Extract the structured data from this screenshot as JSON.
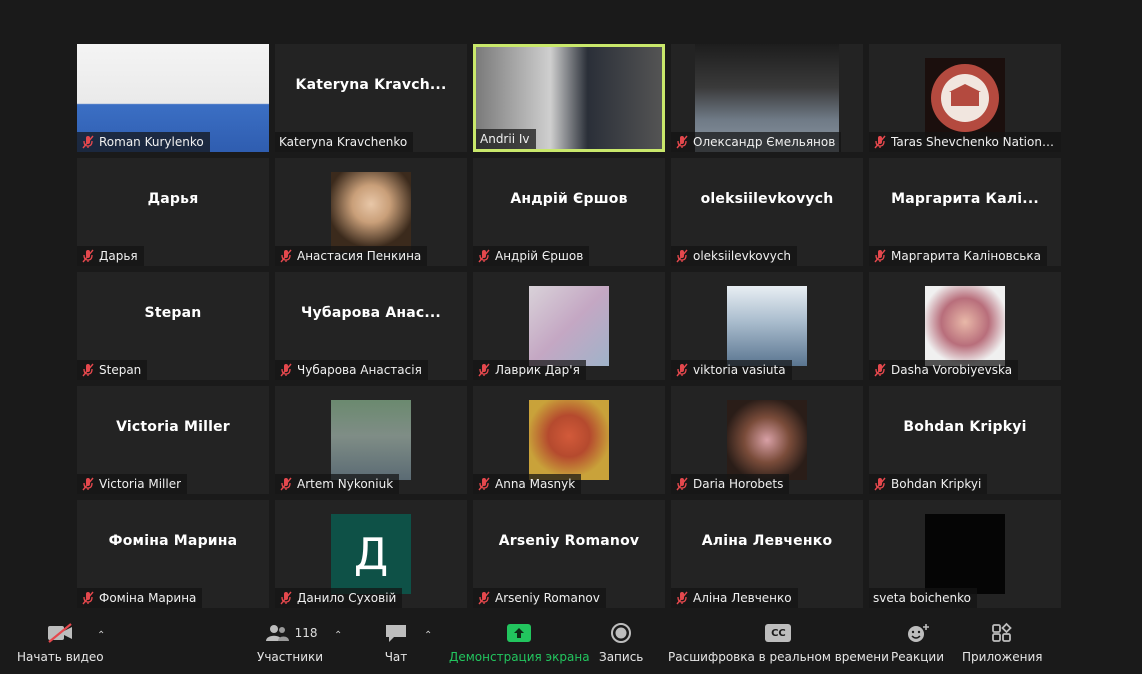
{
  "participants": [
    {
      "name": "Roman Kurylenko",
      "display": "",
      "kind": "video",
      "muted": true
    },
    {
      "name": "Kateryna Kravchenko",
      "display": "Kateryna  Kravch...",
      "kind": "text",
      "muted": false
    },
    {
      "name": "Andrii Iv",
      "display": "",
      "kind": "video",
      "muted": false,
      "active": true
    },
    {
      "name": "Олександр Ємельянов",
      "display": "",
      "kind": "video",
      "muted": true
    },
    {
      "name": "Taras Shevchenko National...",
      "display": "",
      "kind": "logo",
      "muted": true
    },
    {
      "name": "Дарья",
      "display": "Дарья",
      "kind": "text",
      "muted": true
    },
    {
      "name": "Анастасия Пенкина",
      "display": "",
      "kind": "photo",
      "muted": true
    },
    {
      "name": "Андрій Єршов",
      "display": "Андрій Єршов",
      "kind": "text",
      "muted": true
    },
    {
      "name": "oleksiilevkovych",
      "display": "oleksiilevkovych",
      "kind": "text",
      "muted": true
    },
    {
      "name": "Маргарита Каліновська",
      "display": "Маргарита  Калі...",
      "kind": "text",
      "muted": true
    },
    {
      "name": "Stepan",
      "display": "Stepan",
      "kind": "text",
      "muted": true
    },
    {
      "name": "Чубарова Анастасія",
      "display": "Чубарова  Анас...",
      "kind": "text",
      "muted": true
    },
    {
      "name": "Лаврик Дар'я",
      "display": "",
      "kind": "photo",
      "muted": true
    },
    {
      "name": "viktoria vasiuta",
      "display": "",
      "kind": "photo",
      "muted": true
    },
    {
      "name": "Dasha Vorobiyevska",
      "display": "",
      "kind": "photo",
      "muted": true
    },
    {
      "name": "Victoria Miller",
      "display": "Victoria Miller",
      "kind": "text",
      "muted": true
    },
    {
      "name": "Artem Nykoniuk",
      "display": "",
      "kind": "photo",
      "muted": true
    },
    {
      "name": "Anna Masnyk",
      "display": "",
      "kind": "photo",
      "muted": true
    },
    {
      "name": "Daria Horobets",
      "display": "",
      "kind": "photo",
      "muted": true
    },
    {
      "name": "Bohdan Kripkyi",
      "display": "Bohdan Kripkyi",
      "kind": "text",
      "muted": true
    },
    {
      "name": "Фоміна Марина",
      "display": "Фоміна Марина",
      "kind": "text",
      "muted": true
    },
    {
      "name": "Данило Суховій",
      "display": "",
      "kind": "letter",
      "letter": "Д",
      "muted": true
    },
    {
      "name": "Arseniy Romanov",
      "display": "Arseniy Romanov",
      "kind": "text",
      "muted": true
    },
    {
      "name": "Аліна Левченко",
      "display": "Аліна Левченко",
      "kind": "text",
      "muted": true
    },
    {
      "name": "sveta boichenko",
      "display": "",
      "kind": "black",
      "muted": false
    }
  ],
  "toolbar": {
    "video_label": "Начать видео",
    "participants_label": "Участники",
    "participants_count": "118",
    "chat_label": "Чат",
    "share_label": "Демонстрация экрана",
    "record_label": "Запись",
    "transcript_label": "Расшифровка в реальном времени",
    "cc_icon_text": "CC",
    "reactions_label": "Реакции",
    "apps_label": "Приложения"
  },
  "colors": {
    "active_border": "#c9e86b",
    "share_green": "#22c55e",
    "mute_red": "#e5484d"
  },
  "icons": {
    "mute": "mic-muted-icon",
    "video": "video-off-icon",
    "participants": "participants-icon",
    "chat": "chat-icon",
    "share": "share-screen-icon",
    "record": "record-icon",
    "transcript": "captions-icon",
    "reactions": "reactions-icon",
    "apps": "apps-icon"
  }
}
